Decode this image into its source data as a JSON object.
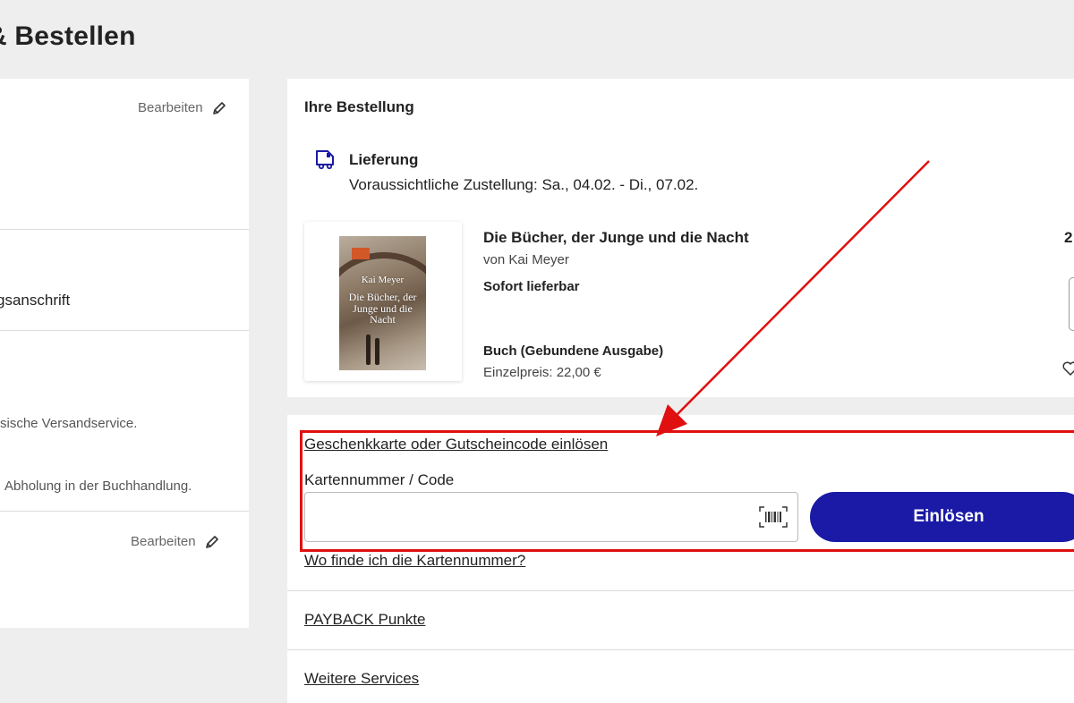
{
  "page": {
    "title": "& Bestellen"
  },
  "left": {
    "edit_label_1": "Bearbeiten",
    "edit_label_2": "Bearbeiten",
    "address_heading": "gsanschrift",
    "shipping_text": "sische Versandservice.",
    "pickup_text": "Abholung in der Buchhandlung."
  },
  "order": {
    "title": "Ihre Bestellung",
    "delivery_label": "Lieferung",
    "delivery_text": "Voraussichtliche Zustellung: Sa., 04.02. - Di., 07.02.",
    "item": {
      "title": "Die Bücher, der Junge und die Nacht",
      "author": "von Kai Meyer",
      "availability": "Sofort lieferbar",
      "format": "Buch (Gebundene Ausgabe)",
      "unit_price": "Einzelpreis: 22,00 €",
      "price_peek": "2",
      "cover_author": "Kai Meyer",
      "cover_title": "Die Bücher, der Junge und die Nacht"
    }
  },
  "voucher": {
    "link_label": "Geschenkkarte oder Gutscheincode einlösen",
    "field_label": "Kartennummer / Code",
    "input_value": "",
    "redeem_label": "Einlösen",
    "help_link": "Wo finde ich die Kartennummer?"
  },
  "services": {
    "payback_label": "PAYBACK Punkte",
    "more_label": "Weitere Services"
  },
  "colors": {
    "accent": "#1a1aa6",
    "highlight": "#e01010",
    "background": "#eeeeee"
  }
}
